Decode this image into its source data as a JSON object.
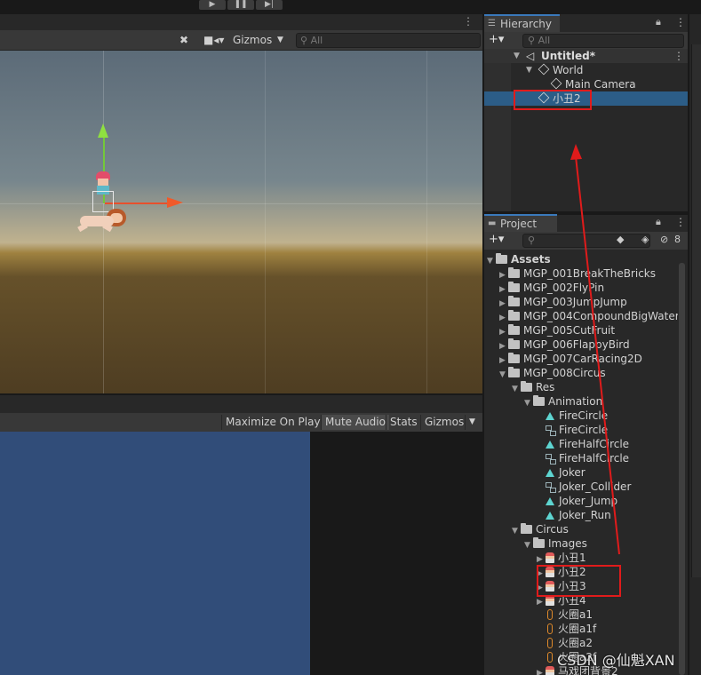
{
  "scene": {
    "toolbar": {
      "gizmos_label": "Gizmos",
      "search_placeholder": "All"
    }
  },
  "game": {
    "toolbar": {
      "maximize_label": "Maximize On Play",
      "mute_label": "Mute Audio",
      "stats_label": "Stats",
      "gizmos_label": "Gizmos"
    }
  },
  "hierarchy": {
    "tab_label": "Hierarchy",
    "add_label": "+▾",
    "search_placeholder": "All",
    "scene_name": "Untitled*",
    "items": [
      {
        "label": "World",
        "depth": 1,
        "expanded": true
      },
      {
        "label": "Main Camera",
        "depth": 2
      },
      {
        "label": "小丑2",
        "depth": 1,
        "selected": true
      }
    ]
  },
  "project": {
    "tab_label": "Project",
    "add_label": "+▾",
    "hidden_count": "8",
    "tree": [
      {
        "label": "Assets",
        "type": "folder",
        "depth": 0,
        "expanded": true
      },
      {
        "label": "MGP_001BreakTheBricks",
        "type": "folder",
        "depth": 1
      },
      {
        "label": "MGP_002FlyPin",
        "type": "folder",
        "depth": 1
      },
      {
        "label": "MGP_003JumpJump",
        "type": "folder",
        "depth": 1
      },
      {
        "label": "MGP_004CompoundBigWater",
        "type": "folder",
        "depth": 1
      },
      {
        "label": "MGP_005CutFruit",
        "type": "folder",
        "depth": 1
      },
      {
        "label": "MGP_006FlappyBird",
        "type": "folder",
        "depth": 1
      },
      {
        "label": "MGP_007CarRacing2D",
        "type": "folder",
        "depth": 1
      },
      {
        "label": "MGP_008Circus",
        "type": "folder",
        "depth": 1,
        "expanded": true
      },
      {
        "label": "Res",
        "type": "folder",
        "depth": 2,
        "expanded": true
      },
      {
        "label": "Animation",
        "type": "folder",
        "depth": 3,
        "expanded": true
      },
      {
        "label": "FireCircle",
        "type": "anim",
        "depth": 4
      },
      {
        "label": "FireCircle",
        "type": "controller",
        "depth": 4
      },
      {
        "label": "FireHalfCircle",
        "type": "anim",
        "depth": 4
      },
      {
        "label": "FireHalfCircle",
        "type": "controller",
        "depth": 4
      },
      {
        "label": "Joker",
        "type": "anim",
        "depth": 4
      },
      {
        "label": "Joker_Collider",
        "type": "controller",
        "depth": 4
      },
      {
        "label": "Joker_Jump",
        "type": "anim",
        "depth": 4
      },
      {
        "label": "Joker_Run",
        "type": "anim",
        "depth": 4
      },
      {
        "label": "Circus",
        "type": "folder",
        "depth": 2,
        "expanded": true
      },
      {
        "label": "Images",
        "type": "folder",
        "depth": 3,
        "expanded": true
      },
      {
        "label": "小丑1",
        "type": "sprite",
        "depth": 4
      },
      {
        "label": "小丑2",
        "type": "sprite",
        "depth": 4
      },
      {
        "label": "小丑3",
        "type": "sprite",
        "depth": 4
      },
      {
        "label": "小丑4",
        "type": "sprite",
        "depth": 4
      },
      {
        "label": "火圈a1",
        "type": "ring",
        "depth": 4
      },
      {
        "label": "火圈a1f",
        "type": "ring",
        "depth": 4
      },
      {
        "label": "火圈a2",
        "type": "ring",
        "depth": 4
      },
      {
        "label": "火圈a2f",
        "type": "ring",
        "depth": 4
      },
      {
        "label": "马戏团背景2",
        "type": "sprite",
        "depth": 4
      }
    ]
  },
  "watermark": "CSDN @仙魁XAN",
  "colors": {
    "selection": "#2c5d87",
    "annotation_red": "#e01b1b",
    "tab_accent": "#3a79bb",
    "game_bg": "#314d79"
  }
}
